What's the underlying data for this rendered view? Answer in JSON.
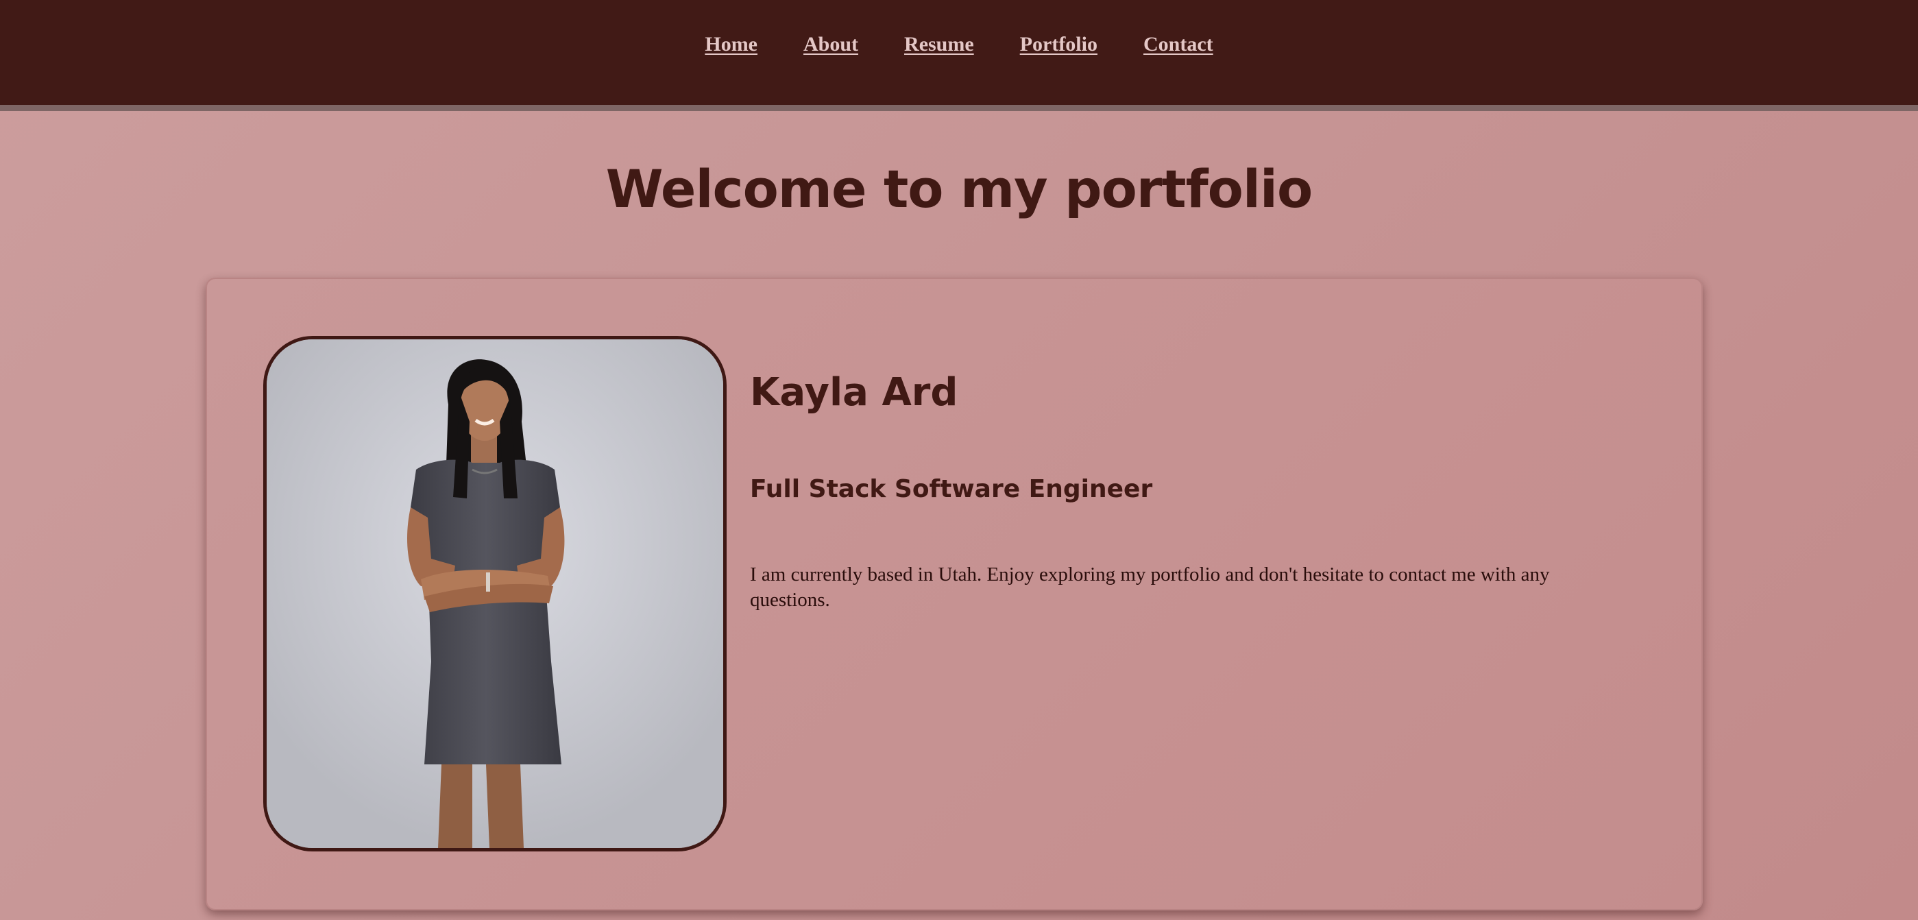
{
  "nav": {
    "items": [
      {
        "label": "Home"
      },
      {
        "label": "About"
      },
      {
        "label": "Resume"
      },
      {
        "label": "Portfolio"
      },
      {
        "label": "Contact"
      }
    ]
  },
  "main": {
    "title": "Welcome to my portfolio"
  },
  "profile": {
    "name": "Kayla Ard",
    "role": "Full Stack Software Engineer",
    "bio": "I am currently based in Utah. Enjoy exploring my portfolio and don't hesitate to contact me with any questions."
  },
  "colors": {
    "navbar_bg": "#411a16",
    "nav_link": "#e4c7c6",
    "page_bg": "#c69494",
    "heading": "#401914"
  }
}
